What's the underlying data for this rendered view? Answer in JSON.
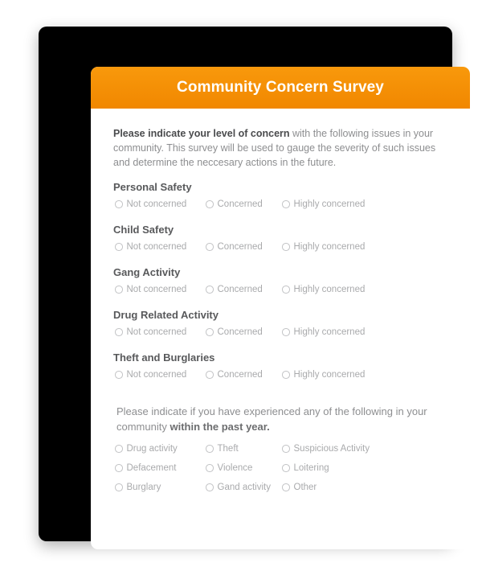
{
  "header": {
    "title": "Community Concern Survey",
    "gradient_top": "#f8990c",
    "gradient_bottom": "#f18700",
    "title_color": "#ffffff"
  },
  "intro": {
    "bold_part": "Please indicate your level of concern",
    "rest": " with the following issues in your community. This survey will be used to gauge the severity of such issues and determine the neccesary actions in the future."
  },
  "scale_options": [
    "Not concerned",
    "Concerned",
    "Highly concerned"
  ],
  "questions": [
    {
      "label": "Personal Safety"
    },
    {
      "label": "Child Safety"
    },
    {
      "label": "Gang Activity"
    },
    {
      "label": "Drug Related Activity"
    },
    {
      "label": "Theft and Burglaries"
    }
  ],
  "section2": {
    "intro_normal_start": "Please indicate if you have experienced any of the following in your community ",
    "intro_bold_end": "within the past year.",
    "options": [
      [
        "Drug activity",
        "Theft",
        "Suspicious Activity"
      ],
      [
        "Defacement",
        "Violence",
        "Loitering"
      ],
      [
        "Burglary",
        "Gand activity",
        "Other"
      ]
    ]
  }
}
